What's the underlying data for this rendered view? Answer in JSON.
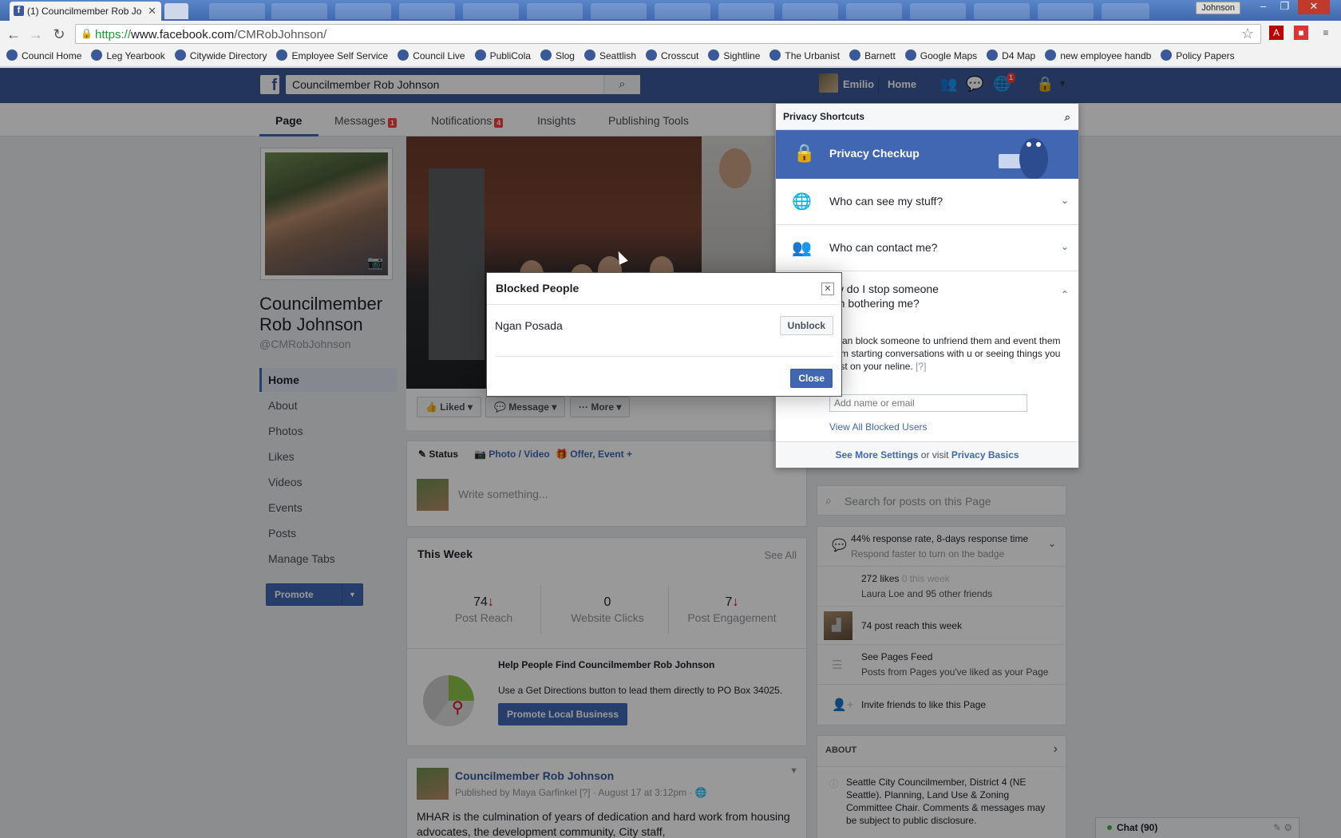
{
  "browser": {
    "tab_title": "(1) Councilmember Rob Jo",
    "tab_favicon": "f",
    "window_user": "Johnson",
    "url_scheme": "https://",
    "url_host": "www.facebook.com",
    "url_path": "/CMRobJohnson/",
    "bookmarks": [
      {
        "label": "Council Home",
        "icon": "seattle-logo-icon"
      },
      {
        "label": "Leg Yearbook",
        "icon": "seattle-logo-icon"
      },
      {
        "label": "Citywide Directory",
        "icon": "seattle-logo-icon"
      },
      {
        "label": "Employee Self Service",
        "icon": "seattle-logo-icon"
      },
      {
        "label": "Council Live",
        "icon": "seattle-logo-icon"
      },
      {
        "label": "PubliCola",
        "icon": "publicola-icon"
      },
      {
        "label": "Slog",
        "icon": "slog-icon"
      },
      {
        "label": "Seattlish",
        "icon": "seattlish-icon"
      },
      {
        "label": "Crosscut",
        "icon": "crosscut-icon"
      },
      {
        "label": "Sightline",
        "icon": "sightline-icon"
      },
      {
        "label": "The Urbanist",
        "icon": "urbanist-icon"
      },
      {
        "label": "Barnett",
        "icon": "barnett-icon"
      },
      {
        "label": "Google Maps",
        "icon": "google-maps-icon"
      },
      {
        "label": "D4 Map",
        "icon": "map-icon"
      },
      {
        "label": "new employee handb",
        "icon": "page-icon"
      },
      {
        "label": "Policy Papers",
        "icon": "folder-icon"
      }
    ]
  },
  "fb": {
    "search_value": "Councilmember Rob Johnson",
    "user_name": "Emilio",
    "home_label": "Home",
    "notif_count": "1",
    "brand_color": "#3b5998"
  },
  "page_tabs": [
    {
      "label": "Page",
      "badge": ""
    },
    {
      "label": "Messages",
      "badge": "1"
    },
    {
      "label": "Notifications",
      "badge": "4"
    },
    {
      "label": "Insights",
      "badge": ""
    },
    {
      "label": "Publishing Tools",
      "badge": ""
    }
  ],
  "page": {
    "name": "Councilmember Rob Johnson",
    "handle": "@CMRobJohnson",
    "nav": [
      "Home",
      "About",
      "Photos",
      "Likes",
      "Videos",
      "Events",
      "Posts",
      "Manage Tabs"
    ],
    "promote_label": "Promote",
    "liked_label": "Liked",
    "message_label": "Message",
    "more_label": "More"
  },
  "composer": {
    "status": "Status",
    "photo_video": "Photo / Video",
    "offer_event": "Offer, Event +",
    "placeholder": "Write something..."
  },
  "week": {
    "title": "This Week",
    "see_all": "See All",
    "stats": [
      {
        "value": "74",
        "down": true,
        "label": "Post Reach"
      },
      {
        "value": "0",
        "down": false,
        "label": "Website Clicks"
      },
      {
        "value": "7",
        "down": true,
        "label": "Post Engagement"
      }
    ],
    "help_title": "Help People Find Councilmember Rob Johnson",
    "help_desc": "Use a Get Directions button to lead them directly to PO Box 34025.",
    "help_button": "Promote Local Business"
  },
  "post": {
    "author": "Councilmember Rob Johnson",
    "meta": "Published by Maya Garfinkel [?] · August 17 at 3:12pm · ",
    "body": "MHAR is the culmination of years of dedication and hard work from housing advocates, the development community, City staff,"
  },
  "right": {
    "search_placeholder": "Search for posts on this Page",
    "response_line1": "44% response rate, 8-days response time",
    "response_line2": "Respond faster to turn on the badge",
    "likes_count": "272 likes",
    "likes_week": "0 this week",
    "likes_friends": "Laura Loe and 95 other friends",
    "reach": "74 post reach this week",
    "feed_title": "See Pages Feed",
    "feed_desc": "Posts from Pages you've liked as your Page",
    "invite": "Invite friends to like this Page",
    "about_title": "ABOUT",
    "about_text": "Seattle City Councilmember, District 4 (NE Seattle). Planning, Land Use & Zoning Committee Chair. Comments & messages may be subject to public disclosure."
  },
  "chat": {
    "label": "Chat (90)"
  },
  "privacy": {
    "title": "Privacy Shortcuts",
    "checkup": "Privacy Checkup",
    "q1": "Who can see my stuff?",
    "q2": "Who can contact me?",
    "q3_line1": "ow do I stop someone",
    "q3_line2": "om bothering me?",
    "block_desc": "u can block someone to unfriend them and event them from starting conversations with u or seeing things you post on your neline.",
    "block_help": "[?]",
    "add_placeholder": "Add name or email",
    "view_all": "View All Blocked Users",
    "footer_link1": "See More Settings",
    "footer_mid": " or visit ",
    "footer_link2": "Privacy Basics"
  },
  "dialog": {
    "title": "Blocked People",
    "blocked_name": "Ngan Posada",
    "unblock_label": "Unblock",
    "close_label": "Close"
  }
}
